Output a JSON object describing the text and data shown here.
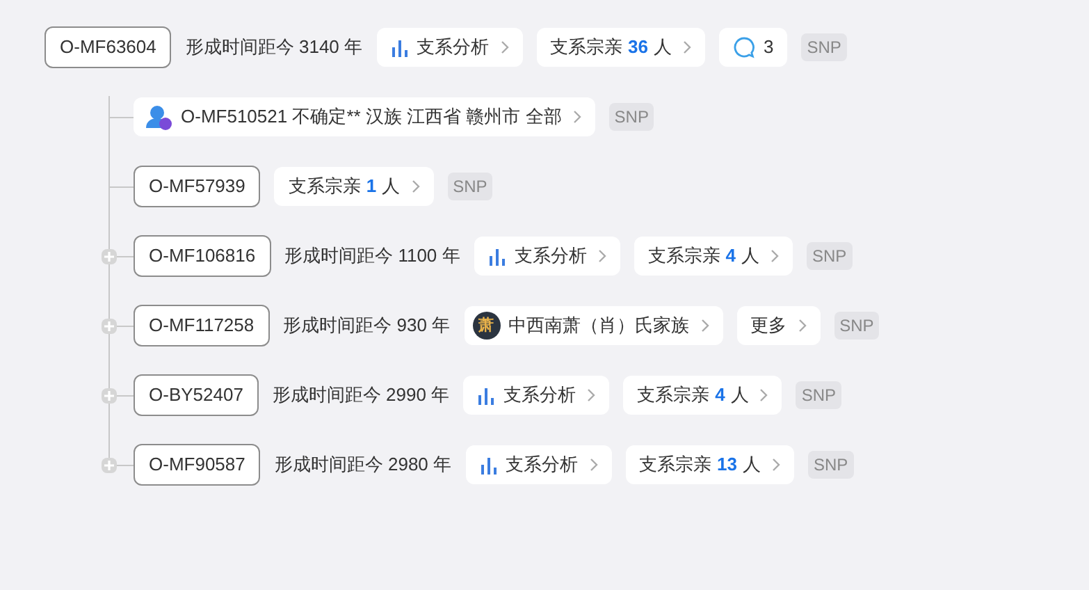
{
  "root": {
    "id": "O-MF63604",
    "time": "形成时间距今 3140 年",
    "chips": [
      {
        "kind": "analysis",
        "label": "支系分析"
      },
      {
        "kind": "kin",
        "prefix": "支系宗亲",
        "count": "36",
        "suffix": "人"
      },
      {
        "kind": "comments",
        "count": "3"
      }
    ],
    "tag": "SNP"
  },
  "children": [
    {
      "kind": "user",
      "text": "O-MF510521 不确定** 汉族 江西省 赣州市 全部",
      "expandable": false,
      "tag": "SNP"
    },
    {
      "kind": "node",
      "id": "O-MF57939",
      "expandable": false,
      "chips": [
        {
          "kind": "kin",
          "prefix": "支系宗亲",
          "count": "1",
          "suffix": "人"
        }
      ],
      "tag": "SNP"
    },
    {
      "kind": "node",
      "id": "O-MF106816",
      "expandable": true,
      "time": "形成时间距今 1100 年",
      "chips": [
        {
          "kind": "analysis",
          "label": "支系分析"
        },
        {
          "kind": "kin",
          "prefix": "支系宗亲",
          "count": "4",
          "suffix": "人"
        }
      ],
      "tag": "SNP"
    },
    {
      "kind": "node",
      "id": "O-MF117258",
      "expandable": true,
      "time": "形成时间距今 930 年",
      "chips": [
        {
          "kind": "family",
          "badge": "萧",
          "label": "中西南萧（肖）氏家族"
        },
        {
          "kind": "more",
          "label": "更多"
        }
      ],
      "tag": "SNP"
    },
    {
      "kind": "node",
      "id": "O-BY52407",
      "expandable": true,
      "time": "形成时间距今 2990 年",
      "chips": [
        {
          "kind": "analysis",
          "label": "支系分析"
        },
        {
          "kind": "kin",
          "prefix": "支系宗亲",
          "count": "4",
          "suffix": "人"
        }
      ],
      "tag": "SNP"
    },
    {
      "kind": "node",
      "id": "O-MF90587",
      "expandable": true,
      "time": "形成时间距今 2980 年",
      "chips": [
        {
          "kind": "analysis",
          "label": "支系分析"
        },
        {
          "kind": "kin",
          "prefix": "支系宗亲",
          "count": "13",
          "suffix": "人"
        }
      ],
      "tag": "SNP"
    }
  ]
}
